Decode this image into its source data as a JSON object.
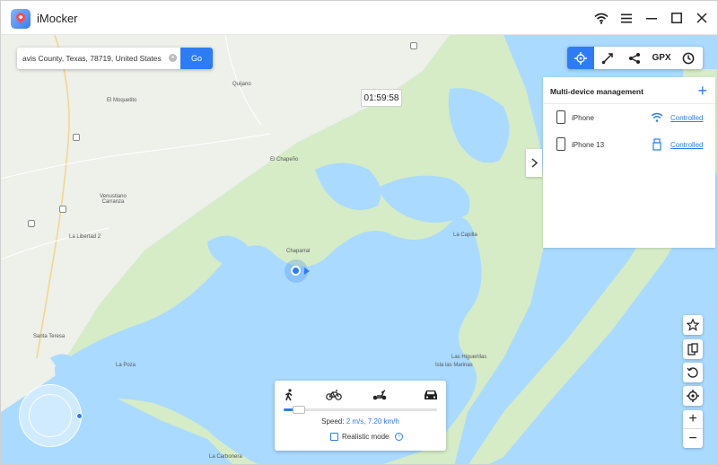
{
  "app": {
    "title": "iMocker"
  },
  "search": {
    "value": "avis County, Texas, 78719, United States",
    "go_label": "Go"
  },
  "timer": "01:59:58",
  "toolbar": {
    "gpx_label": "GPX"
  },
  "devices_panel": {
    "title": "Multi-device management",
    "devices": [
      {
        "name": "iPhone",
        "connection": "wifi-icon",
        "status": "Controlled"
      },
      {
        "name": "iPhone 13",
        "connection": "usb-icon",
        "status": "Controlled"
      }
    ]
  },
  "map": {
    "places": [
      "Quijano",
      "El Moquetito",
      "Venustiano Carranza",
      "El Chapeño",
      "La Libertad 2",
      "Chaparral",
      "La Capilla",
      "Santa Teresa",
      "La Poza",
      "Las Higuerillas",
      "Isla las Marinas",
      "La Carbonera"
    ]
  },
  "speed_panel": {
    "speed_label": "Speed:",
    "speed_value": "2 m/s, 7.20 km/h",
    "speed_fraction": 0.1,
    "realistic_label": "Realistic mode",
    "realistic_checked": false
  },
  "colors": {
    "accent": "#2d7cf6",
    "water": "#aadaff",
    "land": "#d6ecc7",
    "land_gray": "#eef0ea"
  }
}
